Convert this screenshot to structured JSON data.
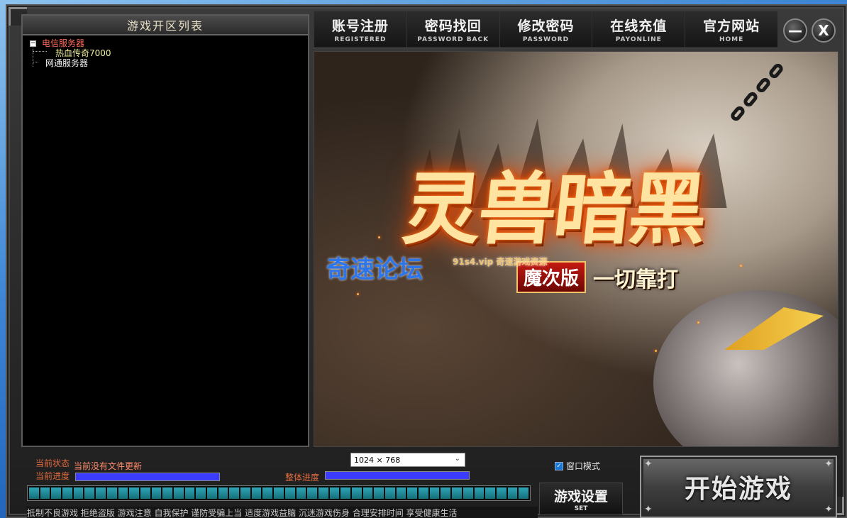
{
  "server_list": {
    "title": "游戏开区列表",
    "groups": [
      {
        "label": "电信服务器",
        "toggle": "−",
        "children": [
          "热血传奇7000"
        ]
      },
      {
        "label": "网通服务器"
      }
    ]
  },
  "nav": [
    {
      "cn": "账号注册",
      "en": "REGISTERED"
    },
    {
      "cn": "密码找回",
      "en": "PASSWORD BACK"
    },
    {
      "cn": "修改密码",
      "en": "PASSWORD"
    },
    {
      "cn": "在线充值",
      "en": "PAYONLINE"
    },
    {
      "cn": "官方网站",
      "en": "HOME"
    }
  ],
  "window_controls": {
    "minimize": "—",
    "close": "X"
  },
  "banner": {
    "title": "灵兽暗黑",
    "subtitle_red": "魔次版",
    "subtitle_gold": "一切靠打",
    "watermark": "奇速论坛",
    "watermark_small": "91s4.vip 奇速游戏资源"
  },
  "status": {
    "current_state_label": "当前状态",
    "current_state_value": "当前没有文件更新",
    "current_progress_label": "当前进度",
    "overall_progress_label": "整体进度",
    "current_progress": 1.0,
    "overall_progress": 1.0
  },
  "resolution": {
    "value": "1024 × 768"
  },
  "windowed": {
    "label": "窗口模式",
    "checked": true
  },
  "segments_count": 45,
  "settings_button": {
    "cn": "游戏设置",
    "en": "SET"
  },
  "start_button": {
    "label": "开始游戏"
  },
  "tips": "抵制不良游戏  拒绝盗版  游戏注意  自我保护  谨防受骗上当  适度游戏益脑  沉迷游戏伤身  合理安排时间  享受健康生活"
}
